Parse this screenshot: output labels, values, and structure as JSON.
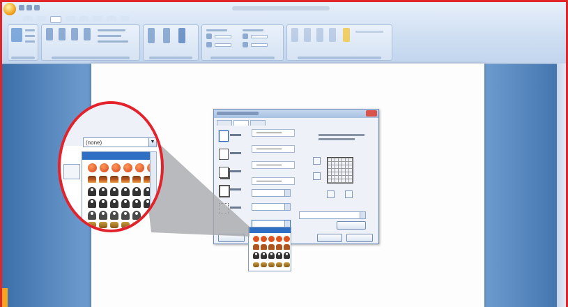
{
  "window": {
    "accent_color": "#e0262a",
    "ribbon_color": "#cfdff2",
    "workspace_color": "#5b8bc2"
  },
  "ribbon": {
    "office_button_icon": "office-orb-icon",
    "active_tab_index": 2
  },
  "dialog": {
    "icon_names": [
      "page-border-box-icon",
      "page-border-shadow-icon",
      "page-border-3d-icon",
      "page-border-custom-icon"
    ],
    "close_icon": "close-icon"
  },
  "art_dropdown": {
    "value": "(none)",
    "arrow_glyph": "▼",
    "art_rows": [
      "orange-dots-art",
      "cake-art",
      "people-art",
      "cats-art"
    ]
  }
}
